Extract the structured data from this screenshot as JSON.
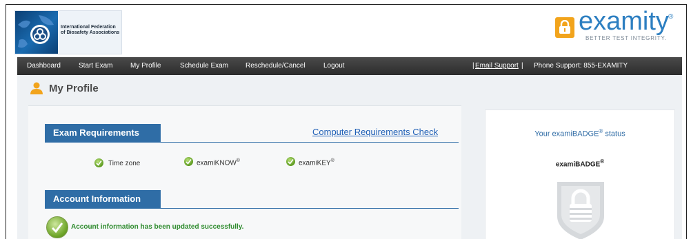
{
  "header": {
    "org_name": "International Federation of Biosafety Associations",
    "brand_name": "examity",
    "brand_reg": "®",
    "tagline": "BETTER TEST INTEGRITY.",
    "brand_color": "#2d7fc1",
    "lock_color": "#f2a41c",
    "icons": [
      "globe-biohazard-logo",
      "lock-icon"
    ]
  },
  "nav": {
    "items": [
      "Dashboard",
      "Start Exam",
      "My Profile",
      "Schedule Exam",
      "Reschedule/Cancel",
      "Logout"
    ],
    "email_support": "Email Support",
    "separator": "|",
    "phone_support": "Phone Support: 855-EXAMITY"
  },
  "page": {
    "title": "My Profile",
    "icon": "user-icon"
  },
  "exam_requirements": {
    "heading": "Exam Requirements",
    "link": "Computer Requirements Check",
    "items": [
      {
        "label": "Time zone",
        "sup": ""
      },
      {
        "label": "examiKNOW",
        "sup": "®"
      },
      {
        "label": "examiKEY",
        "sup": "®"
      }
    ],
    "status_color": "#5c9a1f"
  },
  "account_information": {
    "heading": "Account Information",
    "message": "Account information has been updated successfully."
  },
  "badge": {
    "status_prefix": "Your examiBADGE",
    "status_sup": "®",
    "status_suffix": " status",
    "label": "examiBADGE",
    "label_sup": "®",
    "icon": "shield-lock-icon"
  }
}
